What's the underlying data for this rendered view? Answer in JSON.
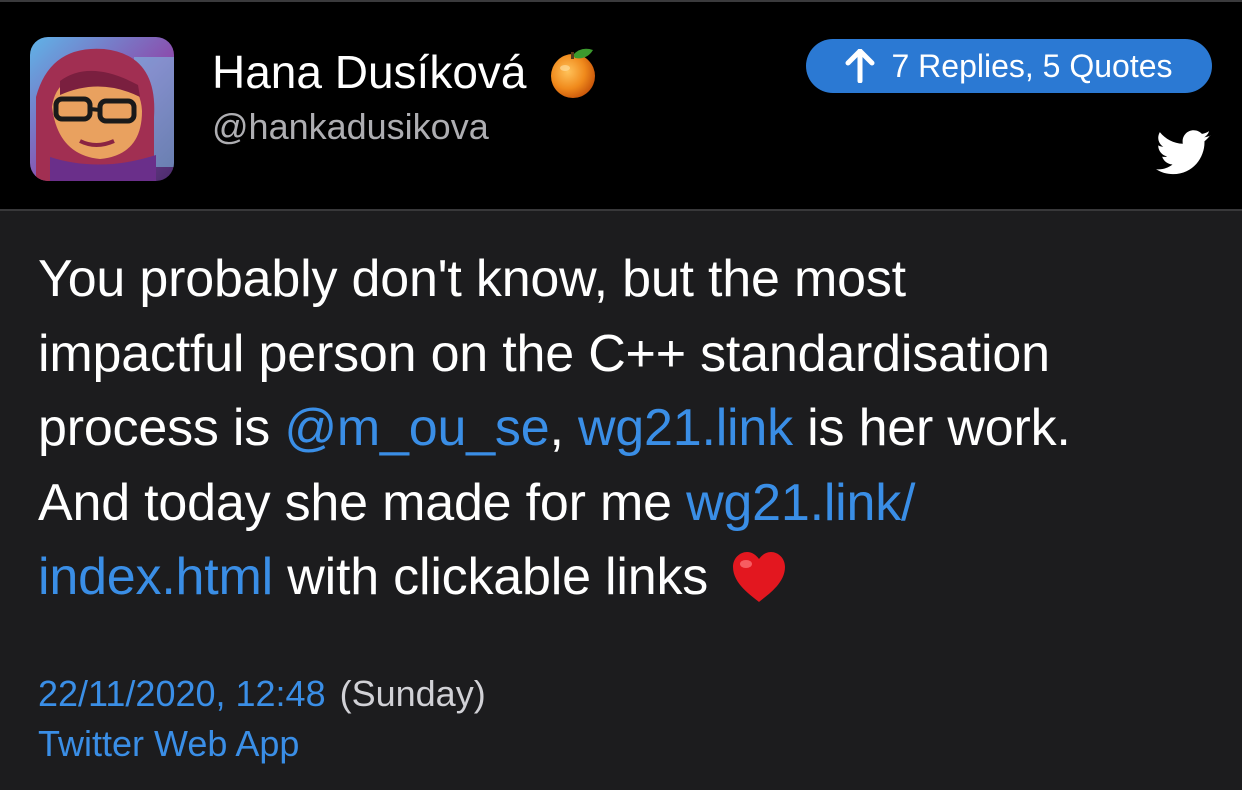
{
  "author": {
    "display_name": "Hana Dusíková",
    "handle": "@hankadusikova",
    "name_emoji_icon": "orange-emoji-icon"
  },
  "replies_button": {
    "label": "7 Replies, 5 Quotes",
    "icon": "arrow-up-icon",
    "color": "#2b79d3"
  },
  "platform_icon": "twitter-bird-icon",
  "tweet": {
    "lines": [
      [
        {
          "text": "You probably don't know, but the most",
          "type": "text"
        }
      ],
      [
        {
          "text": "impactful person on the C++ standardisation",
          "type": "text"
        }
      ],
      [
        {
          "text": "process is ",
          "type": "text"
        },
        {
          "text": "@m_ou_se",
          "type": "mention"
        },
        {
          "text": ", ",
          "type": "text"
        },
        {
          "text": "wg21.link",
          "type": "link"
        },
        {
          "text": " is her work.",
          "type": "text"
        }
      ],
      [
        {
          "text": "And today she made for me ",
          "type": "text"
        },
        {
          "text": "wg21.link/",
          "type": "link"
        }
      ],
      [
        {
          "text": "index.html",
          "type": "link"
        },
        {
          "text": " with clickable links ",
          "type": "text"
        }
      ]
    ],
    "trailing_emoji_icon": "red-heart-emoji-icon"
  },
  "timestamp": {
    "date": "22/11/2020, 12:48",
    "weekday": "(Sunday)"
  },
  "source": "Twitter Web App",
  "colors": {
    "link": "#3a8ee6",
    "header_bg": "#000000",
    "body_bg": "#1c1c1e",
    "text": "#ffffff",
    "secondary_text": "#aeaeb2"
  }
}
